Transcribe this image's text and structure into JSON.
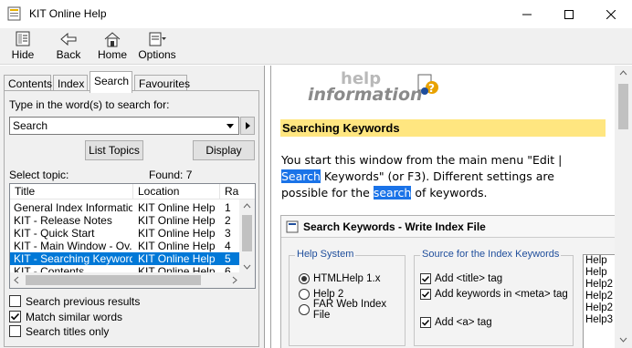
{
  "window": {
    "title": "KIT Online Help"
  },
  "toolbar": {
    "hide": "Hide",
    "back": "Back",
    "home": "Home",
    "options": "Options"
  },
  "tabs": [
    "Contents",
    "Index",
    "Search",
    "Favourites"
  ],
  "search": {
    "prompt": "Type in the word(s) to search for:",
    "value": "Search",
    "list_topics": "List Topics",
    "display": "Display",
    "select_topic": "Select topic:",
    "found": "Found: 7"
  },
  "results": {
    "columns": [
      "Title",
      "Location",
      "Ra"
    ],
    "rows": [
      {
        "title": "General Index Information",
        "location": "KIT Online Help",
        "rank": "1"
      },
      {
        "title": "KIT - Release Notes",
        "location": "KIT Online Help",
        "rank": "2"
      },
      {
        "title": "KIT - Quick Start",
        "location": "KIT Online Help",
        "rank": "3"
      },
      {
        "title": "KIT - Main Window - Ov...",
        "location": "KIT Online Help",
        "rank": "4"
      },
      {
        "title": "KIT - Searching Keywords",
        "location": "KIT Online Help",
        "rank": "5"
      },
      {
        "title": "KIT - Contents",
        "location": "KIT Online Help",
        "rank": "6"
      }
    ]
  },
  "options": {
    "search_previous": "Search previous results",
    "match_similar": "Match similar words",
    "titles_only": "Search titles only"
  },
  "content": {
    "logo_text": "help information",
    "heading": "Searching Keywords",
    "p1_a": "You start this window from the main menu \"Edit |",
    "p1_hl1": "Search",
    "p1_b": " Keywords\" (or F3). Different settings are",
    "p1_c": "possible for the ",
    "p1_hl2": "search",
    "p1_d": " of keywords."
  },
  "dialog": {
    "title": "Search Keywords - Write Index File",
    "help_system_label": "Help System",
    "radios": [
      "HTMLHelp 1.x",
      "Help 2",
      "FAR Web Index File"
    ],
    "source_label": "Source for the Index Keywords",
    "checks": [
      "Add <title> tag",
      "Add keywords in <meta> tag",
      "Add <a> tag"
    ],
    "list": [
      "Help",
      "Help",
      "Help2",
      "Help2",
      "Help2",
      "Help3"
    ]
  },
  "colors": {
    "selection": "#0078d7",
    "heading_bg": "#ffe680",
    "highlight": "#1a73e8"
  }
}
